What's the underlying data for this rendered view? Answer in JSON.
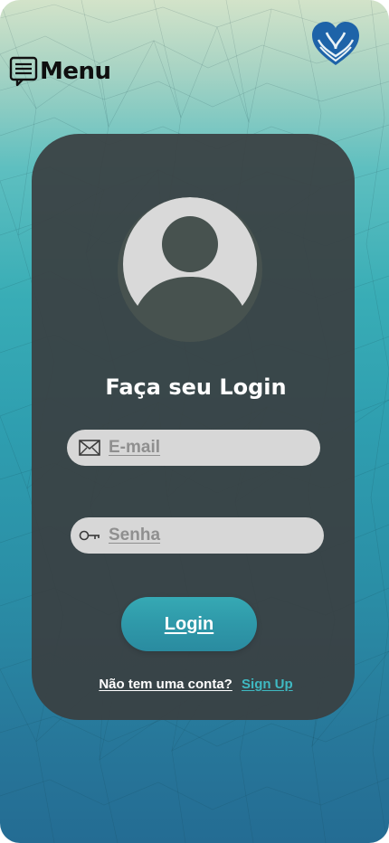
{
  "header": {
    "menu_label": "Menu",
    "menu_icon": "message-list-icon",
    "logo_icon": "heart-wave-logo"
  },
  "login": {
    "title": "Faça seu Login",
    "email": {
      "placeholder": "E-mail",
      "icon": "envelope-icon"
    },
    "password": {
      "placeholder": "Senha",
      "icon": "key-icon"
    },
    "submit_label": "Login",
    "no_account_text": "Não tem uma conta?",
    "signup_label": "Sign Up"
  },
  "colors": {
    "card": "#3a4042",
    "accent": "#3fb9c2",
    "logo": "#1e63a8",
    "input_bg": "#d7d7d7",
    "avatar": "#d9d9d9"
  }
}
